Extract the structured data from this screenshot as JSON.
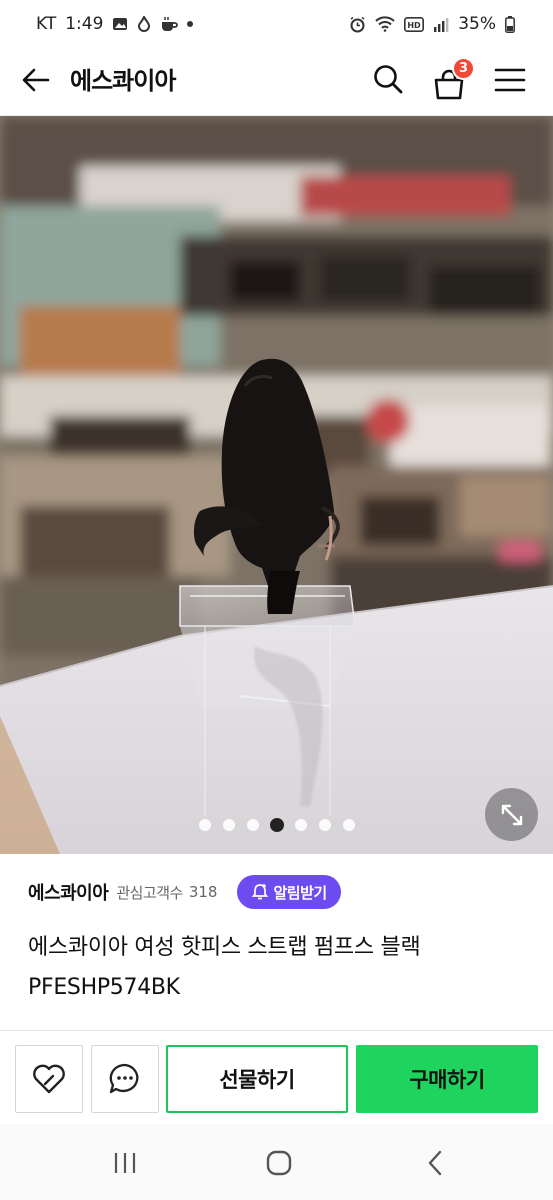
{
  "status_bar": {
    "carrier": "KT",
    "time": "1:49",
    "battery": "35%"
  },
  "header": {
    "title": "에스콰이아",
    "cart_count": "3"
  },
  "gallery": {
    "total_images": 7,
    "active_index": 4
  },
  "seller": {
    "name": "에스콰이아",
    "fans_label": "관심고객수",
    "fans_count": "318",
    "alarm_label": "알림받기"
  },
  "product": {
    "title": "에스콰이아 여성 핫피스 스트랩 펌프스 블랙 PFESHP574BK"
  },
  "actions": {
    "gift_label": "선물하기",
    "buy_label": "구매하기"
  },
  "colors": {
    "brand_green": "#1fd35f",
    "alarm_purple": "#6c4cf0",
    "badge_red": "#f04a36"
  },
  "icons": [
    "back-arrow-icon",
    "search-icon",
    "cart-icon",
    "menu-icon",
    "expand-icon",
    "heart-icon",
    "chat-icon"
  ]
}
